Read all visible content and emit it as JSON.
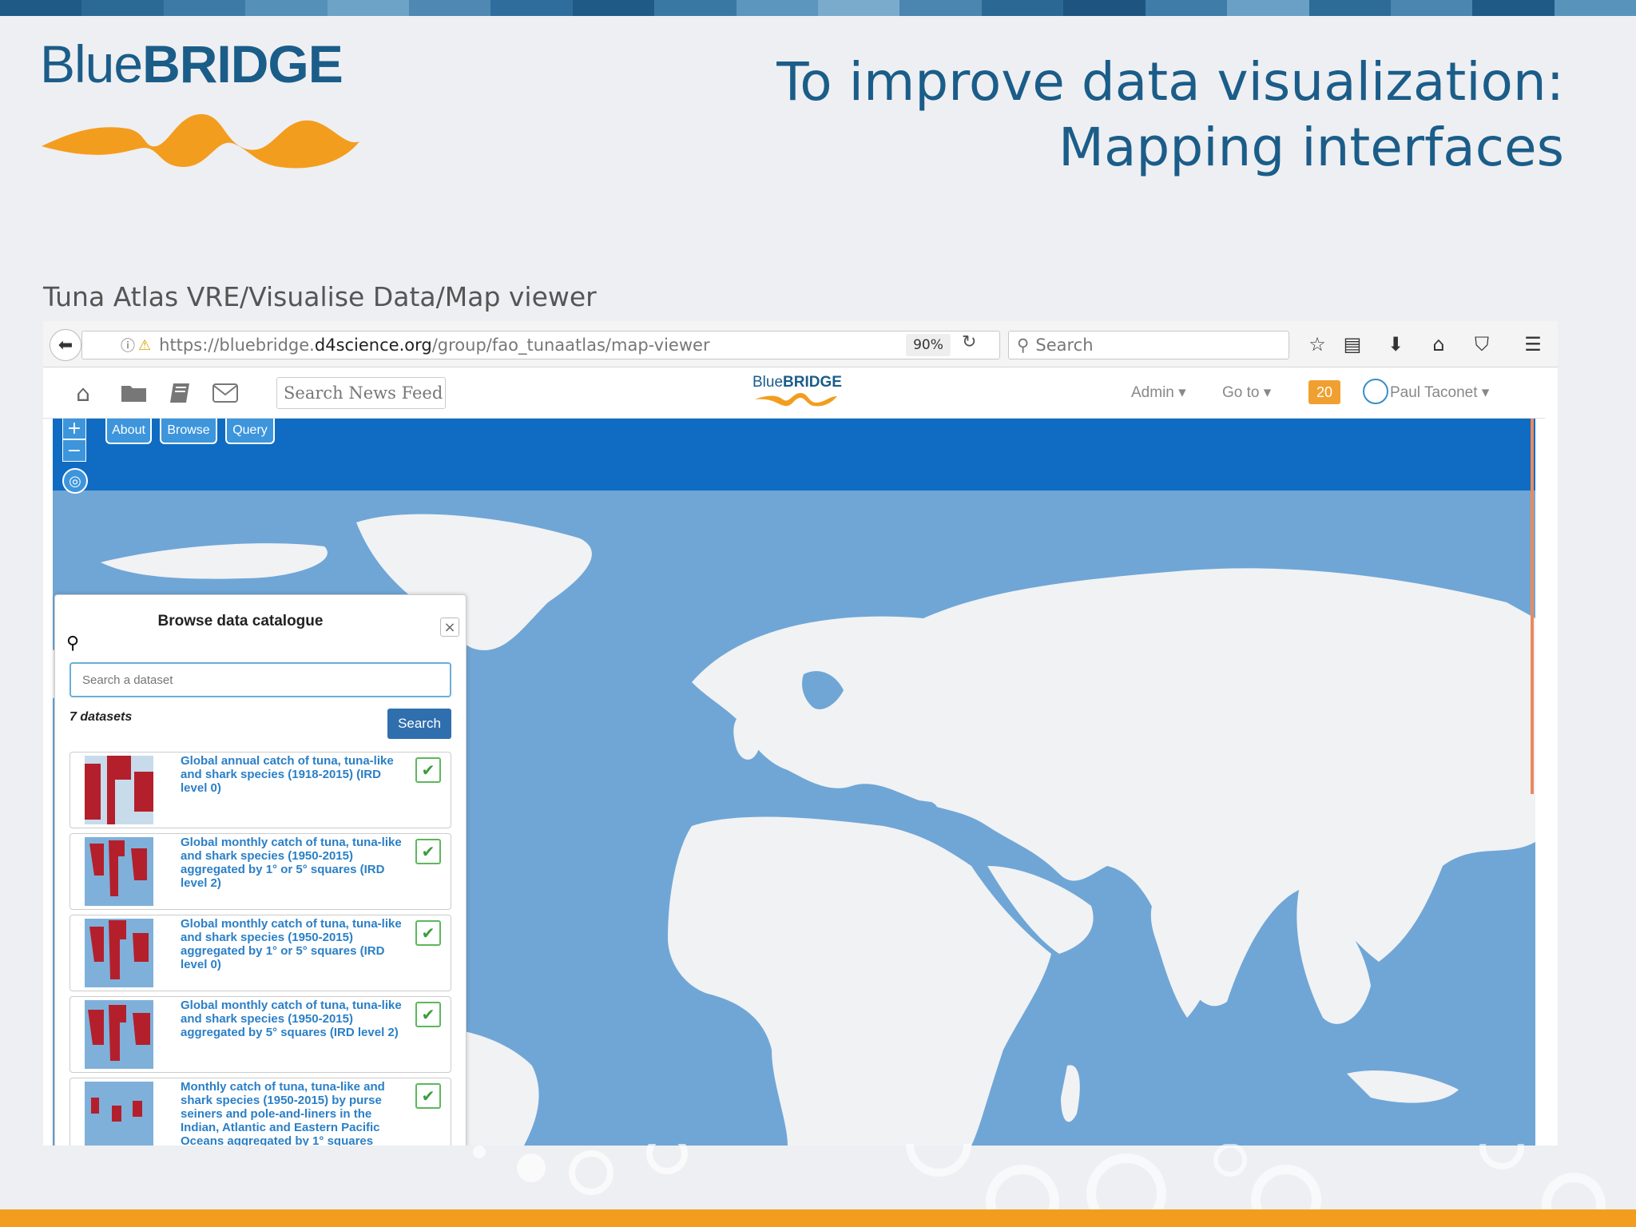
{
  "logo": {
    "blue": "Blue",
    "bridge": "BRIDGE"
  },
  "slide": {
    "title_line1": "To improve data visualization:",
    "title_line2": "Mapping interfaces",
    "subtitle": "Tuna Atlas VRE/Visualise Data/Map viewer"
  },
  "browser": {
    "url_prefix": "https://bluebridge.",
    "url_domain": "d4science.org",
    "url_path": "/group/fao_tunaatlas/map-viewer",
    "zoom": "90%",
    "search_placeholder": "Search"
  },
  "portal": {
    "news_search_placeholder": "Search News Feed",
    "logo_blue": "Blue",
    "logo_bridge": "BRIDGE",
    "admin_menu": "Admin",
    "goto_menu": "Go to",
    "notifications": "20",
    "user_name": "Paul Taconet"
  },
  "map": {
    "buttons": [
      "About",
      "Browse",
      "Query"
    ],
    "zoom_in": "+",
    "zoom_out": "−"
  },
  "catalogue": {
    "title": "Browse data catalogue",
    "search_placeholder": "Search a dataset",
    "count": "7 datasets",
    "search_button": "Search",
    "datasets": [
      {
        "label": "Global annual catch of tuna, tuna-like and shark species (1918-2015) (IRD level 0)"
      },
      {
        "label": "Global monthly catch of tuna, tuna-like and shark species (1950-2015) aggregated by 1° or 5° squares (IRD level 2)"
      },
      {
        "label": "Global monthly catch of tuna, tuna-like and shark species (1950-2015) aggregated by 1° or 5° squares (IRD level 0)"
      },
      {
        "label": "Global monthly catch of tuna, tuna-like and shark species (1950-2015) aggregated by 5° squares (IRD level 2)"
      },
      {
        "label": "Monthly catch of tuna, tuna-like and shark species (1950-2015) by purse seiners and pole-and-liners in the Indian, Atlantic and Eastern Pacific Oceans aggregated by 1° squares"
      }
    ]
  },
  "colors": {
    "brand_blue": "#1b5d89",
    "brand_orange": "#f39d1f",
    "map_ocean": "#6fa6d6",
    "map_band": "#0f6cc2",
    "link_blue": "#2a7fc6"
  },
  "icons": {
    "back": "back-arrow-icon",
    "info": "info-icon",
    "reload": "reload-icon",
    "star": "star-icon",
    "reader": "reader-icon",
    "download": "download-icon",
    "home": "home-icon",
    "pocket": "pocket-icon",
    "menu": "hamburger-menu-icon",
    "folder": "folder-icon",
    "book": "book-icon",
    "mail": "mail-icon",
    "check": "check-icon",
    "close": "close-icon",
    "globe": "globe-icon"
  }
}
